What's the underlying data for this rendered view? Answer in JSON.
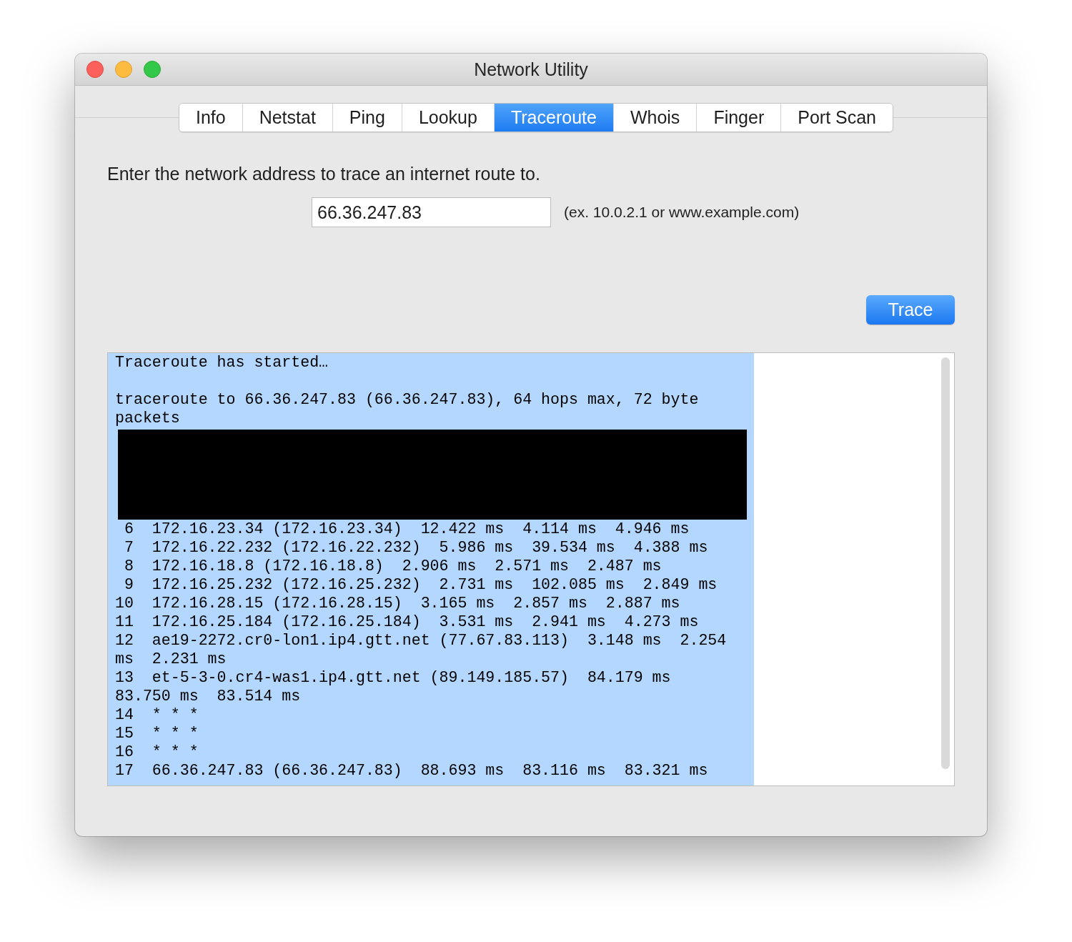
{
  "window": {
    "title": "Network Utility"
  },
  "tabs": [
    {
      "label": "Info",
      "selected": false
    },
    {
      "label": "Netstat",
      "selected": false
    },
    {
      "label": "Ping",
      "selected": false
    },
    {
      "label": "Lookup",
      "selected": false
    },
    {
      "label": "Traceroute",
      "selected": true
    },
    {
      "label": "Whois",
      "selected": false
    },
    {
      "label": "Finger",
      "selected": false
    },
    {
      "label": "Port Scan",
      "selected": false
    }
  ],
  "prompt": "Enter the network address to trace an internet route to.",
  "address_field": {
    "value": "66.36.247.83"
  },
  "hint": "(ex. 10.0.2.1 or www.example.com)",
  "trace_button": "Trace",
  "output": {
    "selected": true,
    "lines": [
      {
        "kind": "text",
        "text": "Traceroute has started…"
      },
      {
        "kind": "blank"
      },
      {
        "kind": "text",
        "text": "traceroute to 66.36.247.83 (66.36.247.83), 64 hops max, 72 byte"
      },
      {
        "kind": "text",
        "text": "packets"
      },
      {
        "kind": "redacted"
      },
      {
        "kind": "text",
        "text": " 6  172.16.23.34 (172.16.23.34)  12.422 ms  4.114 ms  4.946 ms"
      },
      {
        "kind": "text",
        "text": " 7  172.16.22.232 (172.16.22.232)  5.986 ms  39.534 ms  4.388 ms"
      },
      {
        "kind": "text",
        "text": " 8  172.16.18.8 (172.16.18.8)  2.906 ms  2.571 ms  2.487 ms"
      },
      {
        "kind": "text",
        "text": " 9  172.16.25.232 (172.16.25.232)  2.731 ms  102.085 ms  2.849 ms"
      },
      {
        "kind": "text",
        "text": "10  172.16.28.15 (172.16.28.15)  3.165 ms  2.857 ms  2.887 ms"
      },
      {
        "kind": "text",
        "text": "11  172.16.25.184 (172.16.25.184)  3.531 ms  2.941 ms  4.273 ms"
      },
      {
        "kind": "text",
        "text": "12  ae19-2272.cr0-lon1.ip4.gtt.net (77.67.83.113)  3.148 ms  2.254"
      },
      {
        "kind": "text",
        "text": "ms  2.231 ms"
      },
      {
        "kind": "text",
        "text": "13  et-5-3-0.cr4-was1.ip4.gtt.net (89.149.185.57)  84.179 ms"
      },
      {
        "kind": "text",
        "text": "83.750 ms  83.514 ms"
      },
      {
        "kind": "text",
        "text": "14  * * *"
      },
      {
        "kind": "text",
        "text": "15  * * *"
      },
      {
        "kind": "text",
        "text": "16  * * *"
      },
      {
        "kind": "text",
        "text": "17  66.36.247.83 (66.36.247.83)  88.693 ms  83.116 ms  83.321 ms"
      }
    ]
  }
}
